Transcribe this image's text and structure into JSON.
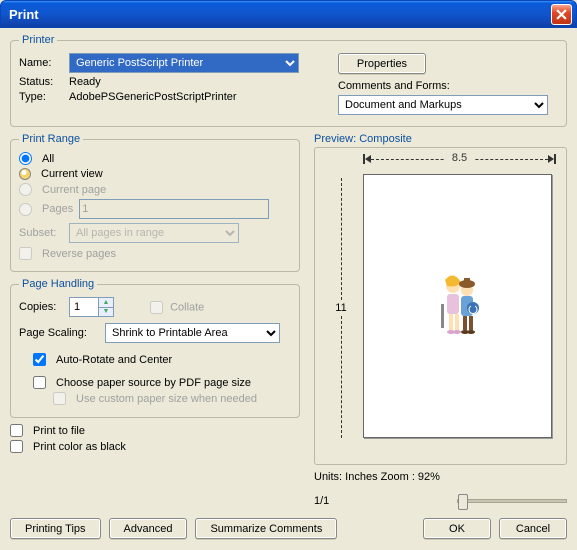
{
  "window": {
    "title": "Print"
  },
  "printer_fs": {
    "legend": "Printer",
    "name_label": "Name:",
    "name_value": "Generic PostScript Printer",
    "status_label": "Status:",
    "status_value": "Ready",
    "type_label": "Type:",
    "type_value": "AdobePSGenericPostScriptPrinter",
    "properties_btn": "Properties",
    "comments_label": "Comments and Forms:",
    "comments_value": "Document and Markups"
  },
  "range_fs": {
    "legend": "Print Range",
    "all": "All",
    "current_view": "Current view",
    "current_page": "Current page",
    "pages": "Pages",
    "pages_val": "1",
    "subset_label": "Subset:",
    "subset_value": "All pages in range",
    "reverse": "Reverse pages"
  },
  "handling_fs": {
    "legend": "Page Handling",
    "copies_label": "Copies:",
    "copies_val": "1",
    "collate": "Collate",
    "scaling_label": "Page Scaling:",
    "scaling_value": "Shrink to Printable Area",
    "auto_rotate": "Auto-Rotate and Center",
    "choose_source": "Choose paper source by PDF page size",
    "custom_paper": "Use custom paper size when needed"
  },
  "misc": {
    "print_to_file": "Print to file",
    "print_color_black": "Print color as black"
  },
  "preview": {
    "label": "Preview: Composite",
    "width": "8.5",
    "height": "11",
    "units_line": "Units: Inches Zoom :  92%",
    "page_indicator": "1/1"
  },
  "buttons": {
    "printing_tips": "Printing Tips",
    "advanced": "Advanced",
    "summarize": "Summarize Comments",
    "ok": "OK",
    "cancel": "Cancel"
  }
}
